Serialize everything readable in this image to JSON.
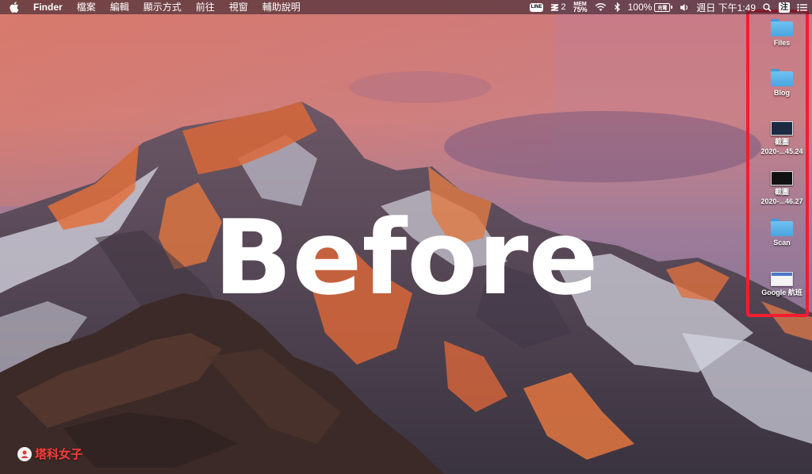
{
  "menubar": {
    "app_name": "Finder",
    "menus": [
      "檔案",
      "編輯",
      "顯示方式",
      "前往",
      "視窗",
      "輔助說明"
    ],
    "status": {
      "line_label": "LINE",
      "dropbox_count": "2",
      "mem_label": "MEM",
      "mem_value": "75%",
      "battery_percent": "100%",
      "battery_icon_label": "充電",
      "clock": "週日 下午1:49",
      "input_method": "注"
    }
  },
  "overlay_text": "Before",
  "desktop_icons": [
    {
      "label": "Files",
      "kind": "folder-icon"
    },
    {
      "label": "Blog",
      "kind": "folder-icon"
    },
    {
      "label": "截圖\n2020-...45.24",
      "kind": "screenshot-icon"
    },
    {
      "label": "截圖\n2020-...46.27",
      "kind": "screenshot-icon"
    },
    {
      "label": "Scan",
      "kind": "folder-icon"
    },
    {
      "label": "Google 航班",
      "kind": "webloc-icon"
    }
  ],
  "watermark": {
    "text": "塔科女子"
  },
  "colors": {
    "highlight": "#f21d2f",
    "folder": "#5ab0e8",
    "watermark": "#ff3c3c"
  }
}
